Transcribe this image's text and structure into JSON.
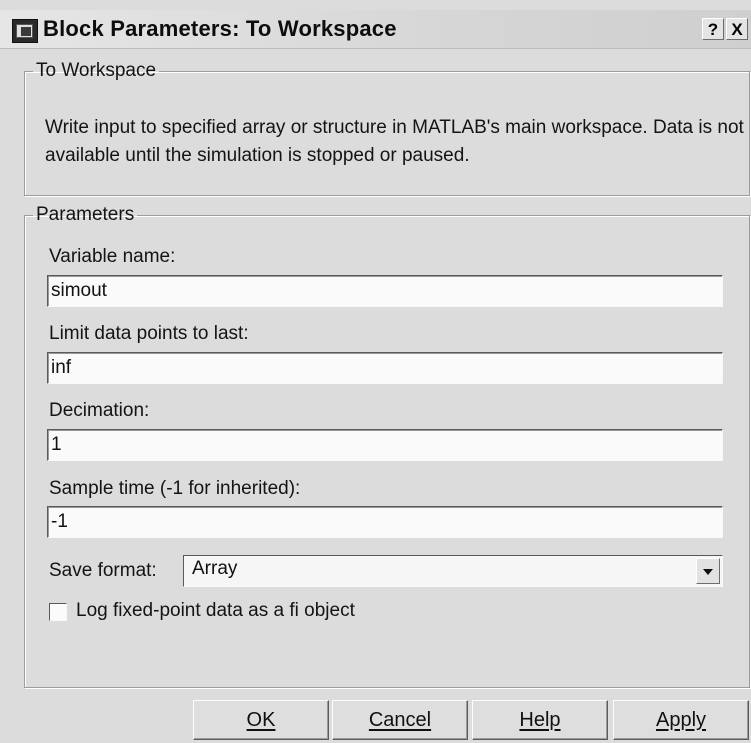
{
  "window": {
    "title": "Block Parameters: To Workspace",
    "help_button": "?",
    "close_button": "X"
  },
  "description_group": {
    "legend": "To Workspace",
    "text": "Write input to specified array or structure in MATLAB's main workspace. Data is not available until the simulation is stopped or paused."
  },
  "parameters_group": {
    "legend": "Parameters",
    "variable_name": {
      "label": "Variable name:",
      "value": "simout"
    },
    "limit_points": {
      "label": "Limit data points to last:",
      "value": "inf"
    },
    "decimation": {
      "label": "Decimation:",
      "value": "1"
    },
    "sample_time": {
      "label": "Sample time (-1 for inherited):",
      "value": "-1"
    },
    "save_format": {
      "label": "Save format:",
      "value": "Array"
    },
    "log_fixed_point": {
      "label": "Log fixed-point data as a fi object",
      "checked": false
    }
  },
  "buttons": {
    "ok": "OK",
    "cancel": "Cancel",
    "help": "Help",
    "apply": "Apply"
  }
}
